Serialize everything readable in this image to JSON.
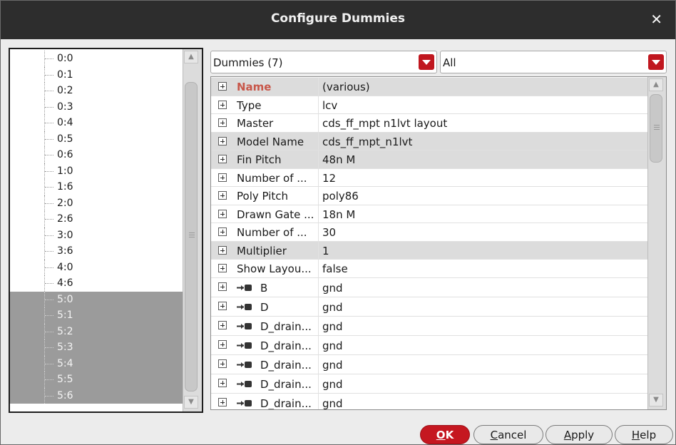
{
  "window": {
    "title": "Configure Dummies",
    "close_glyph": "✕"
  },
  "tree": {
    "items": [
      {
        "label": "0:0",
        "selected": false
      },
      {
        "label": "0:1",
        "selected": false
      },
      {
        "label": "0:2",
        "selected": false
      },
      {
        "label": "0:3",
        "selected": false
      },
      {
        "label": "0:4",
        "selected": false
      },
      {
        "label": "0:5",
        "selected": false
      },
      {
        "label": "0:6",
        "selected": false
      },
      {
        "label": "1:0",
        "selected": false
      },
      {
        "label": "1:6",
        "selected": false
      },
      {
        "label": "2:0",
        "selected": false
      },
      {
        "label": "2:6",
        "selected": false
      },
      {
        "label": "3:0",
        "selected": false
      },
      {
        "label": "3:6",
        "selected": false
      },
      {
        "label": "4:0",
        "selected": false
      },
      {
        "label": "4:6",
        "selected": false
      },
      {
        "label": "5:0",
        "selected": true
      },
      {
        "label": "5:1",
        "selected": true
      },
      {
        "label": "5:2",
        "selected": true
      },
      {
        "label": "5:3",
        "selected": true
      },
      {
        "label": "5:4",
        "selected": true
      },
      {
        "label": "5:5",
        "selected": true
      },
      {
        "label": "5:6",
        "selected": true
      }
    ]
  },
  "filters": {
    "left_value": "Dummies (7)",
    "right_value": "All"
  },
  "properties": {
    "rows": [
      {
        "name": "Name",
        "value": "(various)",
        "highlight": true,
        "bold": true,
        "pin": false
      },
      {
        "name": "Type",
        "value": "lcv",
        "highlight": false,
        "bold": false,
        "pin": false
      },
      {
        "name": "Master",
        "value": "cds_ff_mpt n1lvt layout",
        "highlight": false,
        "bold": false,
        "pin": false
      },
      {
        "name": "Model Name",
        "value": "cds_ff_mpt_n1lvt",
        "highlight": true,
        "bold": false,
        "pin": false
      },
      {
        "name": "Fin Pitch",
        "value": "48n M",
        "highlight": true,
        "bold": false,
        "pin": false
      },
      {
        "name": "Number of ...",
        "value": "12",
        "highlight": false,
        "bold": false,
        "pin": false
      },
      {
        "name": "Poly Pitch",
        "value": "poly86",
        "highlight": false,
        "bold": false,
        "pin": false
      },
      {
        "name": "Drawn Gate ...",
        "value": "18n M",
        "highlight": false,
        "bold": false,
        "pin": false
      },
      {
        "name": "Number of ...",
        "value": "30",
        "highlight": false,
        "bold": false,
        "pin": false
      },
      {
        "name": "Multiplier",
        "value": "1",
        "highlight": true,
        "bold": false,
        "pin": false
      },
      {
        "name": "Show Layou...",
        "value": "false",
        "highlight": false,
        "bold": false,
        "pin": false
      },
      {
        "name": "B",
        "value": "gnd",
        "highlight": false,
        "bold": false,
        "pin": true
      },
      {
        "name": "D",
        "value": "gnd",
        "highlight": false,
        "bold": false,
        "pin": true
      },
      {
        "name": "D_drain...",
        "value": "gnd",
        "highlight": false,
        "bold": false,
        "pin": true
      },
      {
        "name": "D_drain...",
        "value": "gnd",
        "highlight": false,
        "bold": false,
        "pin": true
      },
      {
        "name": "D_drain...",
        "value": "gnd",
        "highlight": false,
        "bold": false,
        "pin": true
      },
      {
        "name": "D_drain...",
        "value": "gnd",
        "highlight": false,
        "bold": false,
        "pin": true
      },
      {
        "name": "D_drain...",
        "value": "gnd",
        "highlight": false,
        "bold": false,
        "pin": true
      }
    ]
  },
  "buttons": {
    "ok": {
      "underline": "O",
      "rest": "K"
    },
    "cancel": {
      "underline": "C",
      "rest": "ancel"
    },
    "apply": {
      "underline": "A",
      "rest": "pply"
    },
    "help": {
      "underline": "H",
      "rest": "elp"
    }
  },
  "colors": {
    "accent_red": "#c51720",
    "titlebar": "#2d2d2d",
    "selection_gray": "#9b9b9b",
    "row_highlight": "#dcdcdc",
    "name_header": "#c8574a"
  },
  "icons": {
    "close": "close-icon",
    "dropdown": "chevron-down-icon",
    "expand": "expand-plus-icon",
    "pin": "pin-connector-icon"
  }
}
